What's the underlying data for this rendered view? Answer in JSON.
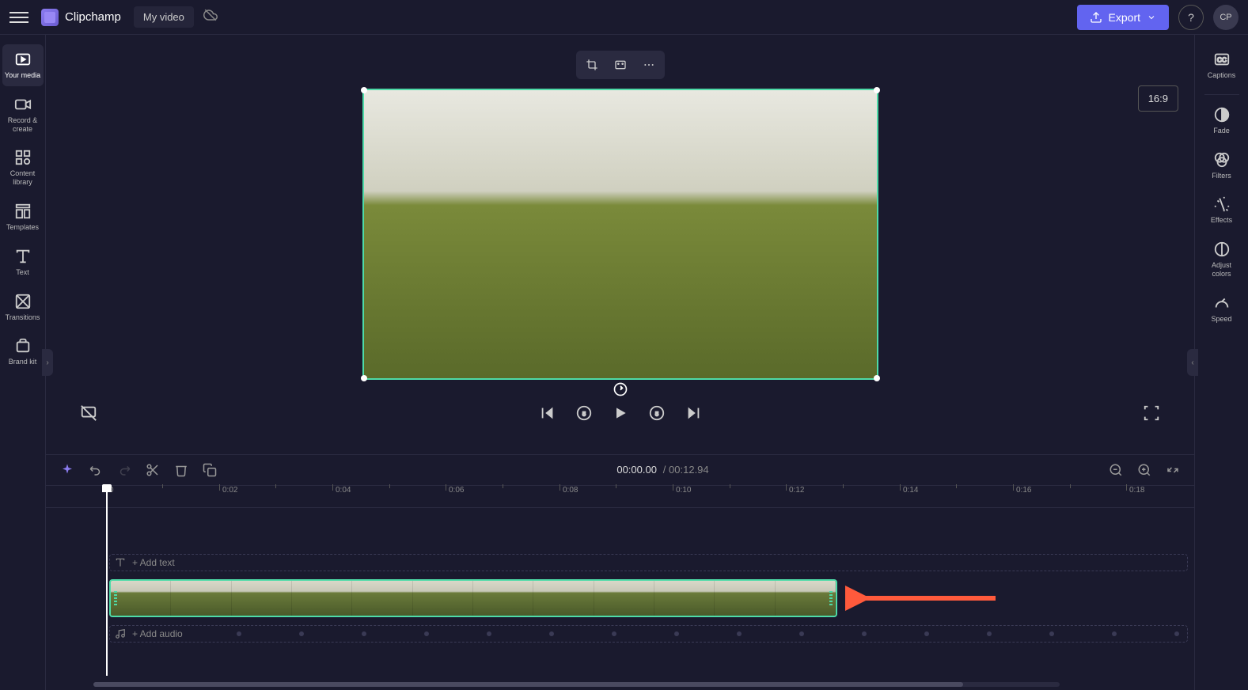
{
  "header": {
    "logo_text": "Clipchamp",
    "project_name": "My video",
    "export_label": "Export",
    "avatar_initials": "CP"
  },
  "left_sidebar": {
    "items": [
      {
        "label": "Your media",
        "icon": "media"
      },
      {
        "label": "Record & create",
        "icon": "record"
      },
      {
        "label": "Content library",
        "icon": "library"
      },
      {
        "label": "Templates",
        "icon": "templates"
      },
      {
        "label": "Text",
        "icon": "text"
      },
      {
        "label": "Transitions",
        "icon": "transitions"
      },
      {
        "label": "Brand kit",
        "icon": "brandkit"
      }
    ]
  },
  "right_sidebar": {
    "items": [
      {
        "label": "Captions",
        "icon": "captions"
      },
      {
        "label": "Fade",
        "icon": "fade"
      },
      {
        "label": "Filters",
        "icon": "filters"
      },
      {
        "label": "Effects",
        "icon": "effects"
      },
      {
        "label": "Adjust colors",
        "icon": "adjust"
      },
      {
        "label": "Speed",
        "icon": "speed"
      }
    ]
  },
  "preview": {
    "aspect_ratio": "16:9"
  },
  "timeline": {
    "current_time": "00:00.00",
    "duration": "00:12.94",
    "separator": "/",
    "ruler_labels": [
      "0",
      "0:02",
      "0:04",
      "0:06",
      "0:08",
      "0:10",
      "0:12",
      "0:14",
      "0:16",
      "0:18"
    ],
    "text_track_placeholder": "+ Add text",
    "audio_track_placeholder": "+ Add audio"
  }
}
